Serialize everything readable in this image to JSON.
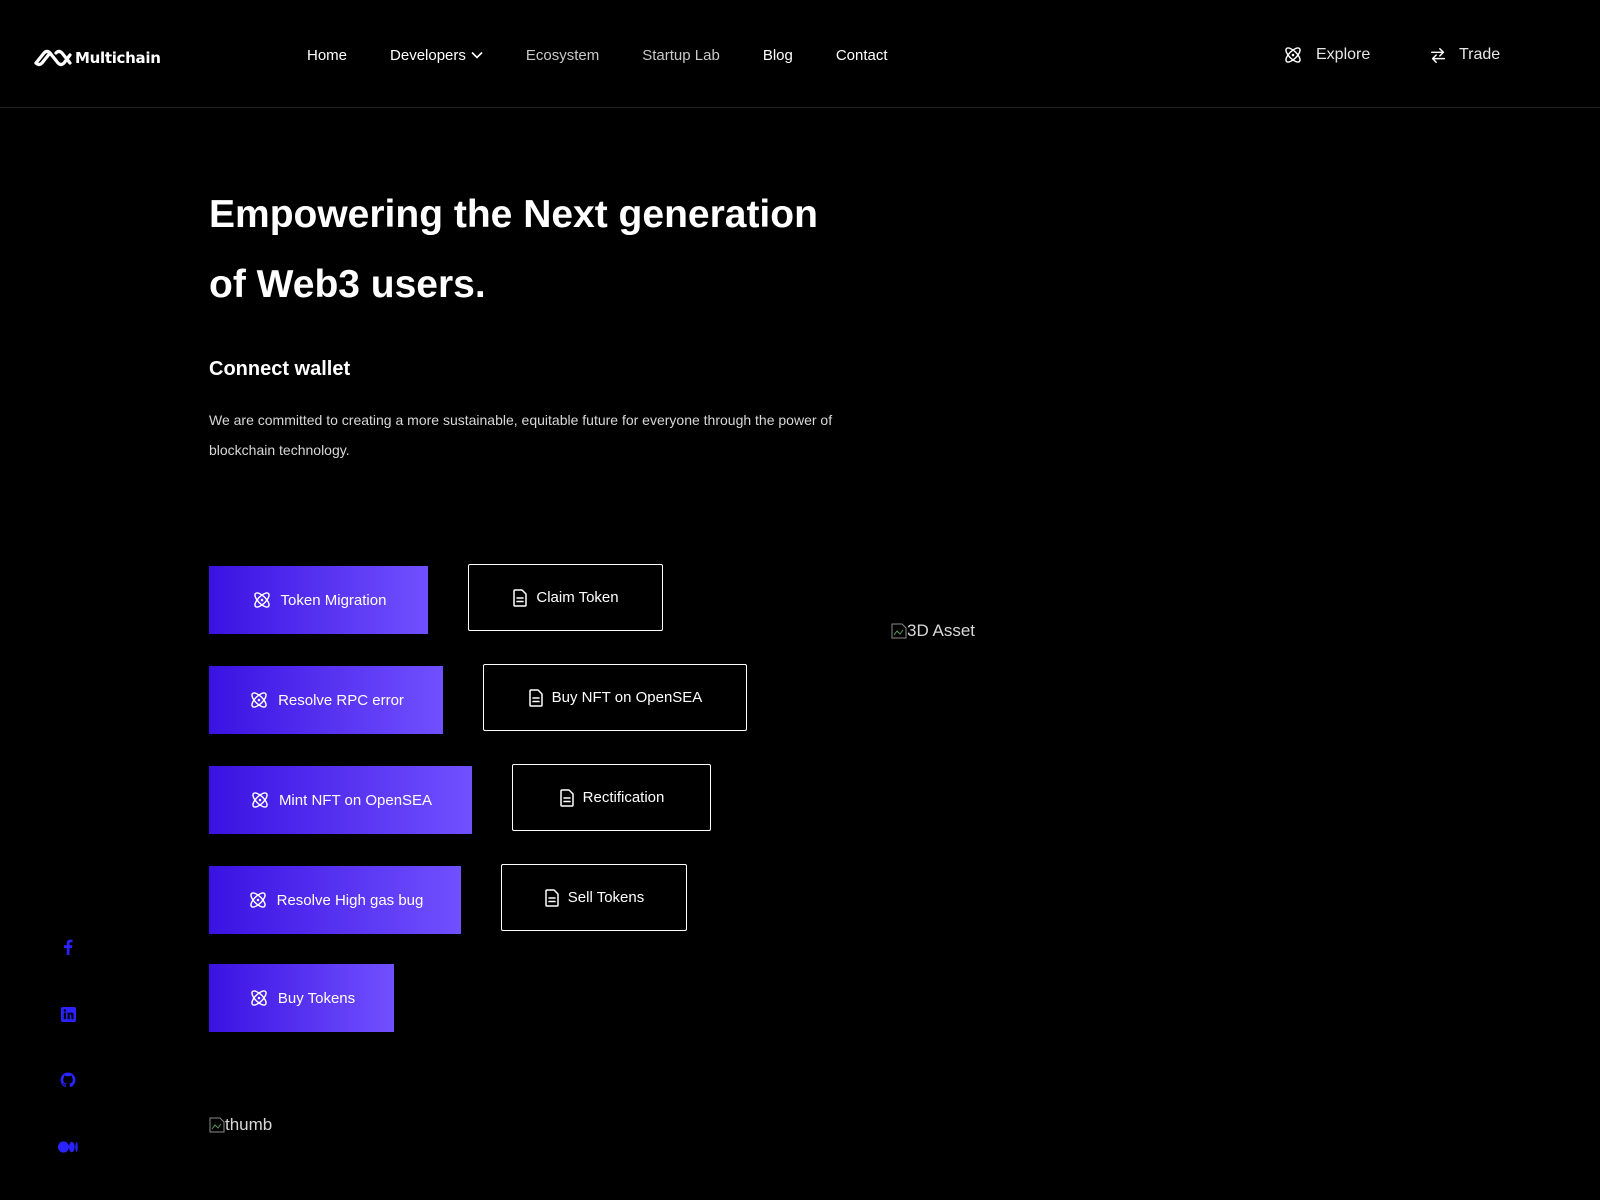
{
  "header": {
    "logo_text": "Multichain",
    "nav": [
      {
        "label": "Home"
      },
      {
        "label": "Developers"
      },
      {
        "label": "Ecosystem"
      },
      {
        "label": "Startup Lab"
      },
      {
        "label": "Blog"
      },
      {
        "label": "Contact"
      }
    ],
    "explore_label": "Explore",
    "trade_label": "Trade"
  },
  "hero": {
    "title_line1": "Empowering the Next generation",
    "title_line2": "of Web3 users.",
    "subtitle": "Connect wallet",
    "description": "We are committed to creating a more sustainable, equitable future for everyone through the power of blockchain technology."
  },
  "actions": {
    "primary": [
      {
        "label": "Token Migration",
        "icon": "atom-icon"
      },
      {
        "label": "Resolve RPC error",
        "icon": "atom-icon"
      },
      {
        "label": "Mint NFT on OpenSEA",
        "icon": "atom-icon"
      },
      {
        "label": "Resolve High gas bug",
        "icon": "atom-icon"
      },
      {
        "label": "Buy Tokens",
        "icon": "atom-icon"
      }
    ],
    "secondary": [
      {
        "label": "Claim Token",
        "icon": "document-icon"
      },
      {
        "label": "Buy NFT on OpenSEA",
        "icon": "document-icon"
      },
      {
        "label": "Rectification",
        "icon": "document-icon"
      },
      {
        "label": "Sell Tokens",
        "icon": "document-icon"
      }
    ]
  },
  "images": {
    "asset_alt": "3D Asset",
    "thumb_alt": "thumb"
  },
  "socials": [
    {
      "icon": "facebook-icon"
    },
    {
      "icon": "linkedin-icon"
    },
    {
      "icon": "github-icon"
    },
    {
      "icon": "medium-icon"
    }
  ],
  "colors": {
    "background": "#000000",
    "accent_start": "#3a12e2",
    "accent_end": "#7150ff",
    "social": "#2a22ff"
  }
}
